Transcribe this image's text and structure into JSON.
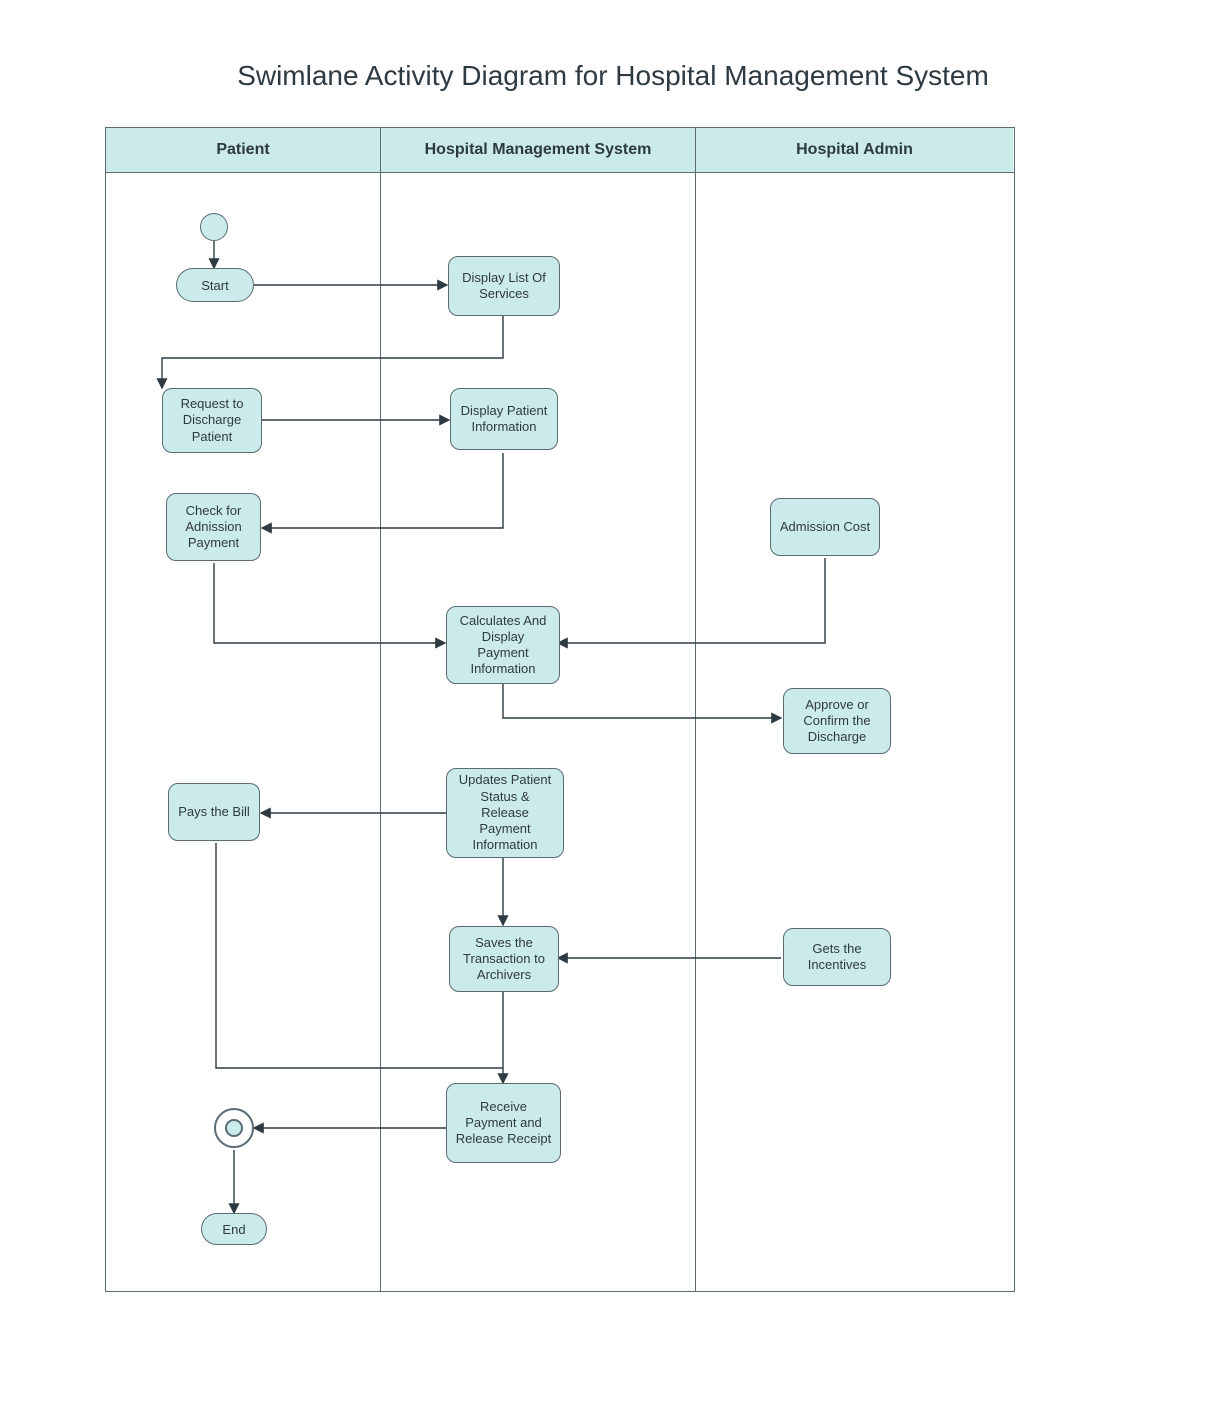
{
  "title": "Swimlane Activity Diagram for Hospital Management System",
  "lanes": {
    "patient": "Patient",
    "hms": "Hospital Management System",
    "admin": "Hospital Admin"
  },
  "nodes": {
    "start": "Start",
    "end": "End",
    "request_discharge": "Request to Discharge Patient",
    "check_admission": "Check for Adnission Payment",
    "pays_bill": "Pays the Bill",
    "display_services": "Display List Of Services",
    "display_patient_info": "Display Patient Information",
    "calculates_display": "Calculates And Display Payment Information",
    "updates_status": "Updates Patient Status & Release Payment Information",
    "saves_transaction": "Saves the Transaction to Archivers",
    "receive_payment": "Receive Payment and Release Receipt",
    "admission_cost": "Admission Cost",
    "approve_discharge": "Approve or Confirm the Discharge",
    "gets_incentives": "Gets the Incentives"
  },
  "chart_data": {
    "type": "diagram",
    "diagram_kind": "uml-activity-swimlane",
    "lanes": [
      "Patient",
      "Hospital Management System",
      "Hospital Admin"
    ],
    "nodes": [
      {
        "id": "initial",
        "lane": "Patient",
        "kind": "initial"
      },
      {
        "id": "start",
        "lane": "Patient",
        "kind": "action",
        "label": "Start"
      },
      {
        "id": "display_services",
        "lane": "Hospital Management System",
        "kind": "action",
        "label": "Display List Of Services"
      },
      {
        "id": "request_discharge",
        "lane": "Patient",
        "kind": "action",
        "label": "Request to Discharge Patient"
      },
      {
        "id": "display_patient_info",
        "lane": "Hospital Management System",
        "kind": "action",
        "label": "Display Patient Information"
      },
      {
        "id": "check_admission",
        "lane": "Patient",
        "kind": "action",
        "label": "Check for Adnission Payment"
      },
      {
        "id": "admission_cost",
        "lane": "Hospital Admin",
        "kind": "action",
        "label": "Admission Cost"
      },
      {
        "id": "calculates_display",
        "lane": "Hospital Management System",
        "kind": "action",
        "label": "Calculates And Display Payment Information"
      },
      {
        "id": "approve_discharge",
        "lane": "Hospital Admin",
        "kind": "action",
        "label": "Approve or Confirm the Discharge"
      },
      {
        "id": "updates_status",
        "lane": "Hospital Management System",
        "kind": "action",
        "label": "Updates Patient Status & Release Payment Information"
      },
      {
        "id": "pays_bill",
        "lane": "Patient",
        "kind": "action",
        "label": "Pays the Bill"
      },
      {
        "id": "saves_transaction",
        "lane": "Hospital Management System",
        "kind": "action",
        "label": "Saves the Transaction to Archivers"
      },
      {
        "id": "gets_incentives",
        "lane": "Hospital Admin",
        "kind": "action",
        "label": "Gets the Incentives"
      },
      {
        "id": "receive_payment",
        "lane": "Hospital Management System",
        "kind": "action",
        "label": "Receive Payment and Release Receipt"
      },
      {
        "id": "final",
        "lane": "Patient",
        "kind": "final"
      },
      {
        "id": "end",
        "lane": "Patient",
        "kind": "action",
        "label": "End"
      }
    ],
    "edges": [
      [
        "initial",
        "start"
      ],
      [
        "start",
        "display_services"
      ],
      [
        "display_services",
        "request_discharge"
      ],
      [
        "request_discharge",
        "display_patient_info"
      ],
      [
        "display_patient_info",
        "check_admission"
      ],
      [
        "check_admission",
        "calculates_display"
      ],
      [
        "admission_cost",
        "calculates_display"
      ],
      [
        "calculates_display",
        "approve_discharge"
      ],
      [
        "updates_status",
        "pays_bill"
      ],
      [
        "updates_status",
        "saves_transaction"
      ],
      [
        "gets_incentives",
        "saves_transaction"
      ],
      [
        "pays_bill",
        "receive_payment"
      ],
      [
        "saves_transaction",
        "receive_payment"
      ],
      [
        "receive_payment",
        "final"
      ],
      [
        "final",
        "end"
      ]
    ]
  }
}
